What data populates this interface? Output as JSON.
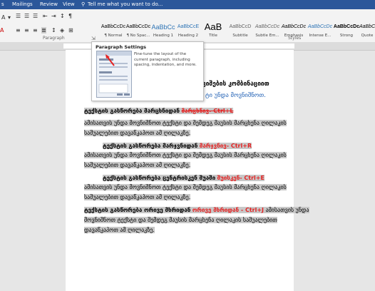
{
  "tabs": [
    "Mailings",
    "Review",
    "View"
  ],
  "tellme": "Tell me what you want to do...",
  "styles": [
    {
      "sample": "AaBbCcDc",
      "name": "¶ Normal",
      "color": "#222"
    },
    {
      "sample": "AaBbCcDc",
      "name": "¶ No Spac...",
      "color": "#222"
    },
    {
      "sample": "AaBbCc",
      "name": "Heading 1",
      "color": "#2e74b5"
    },
    {
      "sample": "AaBbCcE",
      "name": "Heading 2",
      "color": "#2e74b5"
    },
    {
      "sample": "AaB",
      "name": "Title",
      "color": "#222"
    },
    {
      "sample": "AaBbCcD",
      "name": "Subtitle",
      "color": "#666"
    },
    {
      "sample": "AaBbCcDc",
      "name": "Subtle Em...",
      "color": "#666"
    },
    {
      "sample": "AaBbCcDc",
      "name": "Emphasis",
      "color": "#444"
    },
    {
      "sample": "AaBbCcDc",
      "name": "Intense E...",
      "color": "#2e74b5"
    },
    {
      "sample": "AaBbCcDc",
      "name": "Strong",
      "color": "#222"
    },
    {
      "sample": "AaBbCcDc",
      "name": "Quote",
      "color": "#444"
    }
  ],
  "groups": {
    "paragraph": "Paragraph",
    "styles": "Styles"
  },
  "tooltip": {
    "title": "Paragraph Settings",
    "desc": "Fine-tune the layout of the current paragraph, including spacing, indentation, and more."
  },
  "doc": {
    "heading_partial": "ლავიშების კომბინაციით",
    "sub_partial": "ტი უნდა მოვნიშნოთ.",
    "p1_lead": "ტექსტის გასწორება მარცხნიდან",
    "p1_red": "მარცხნივ- Ctrl+L",
    "p1_l1": "ამისათვის უნდა მოვნიშნოთ ტექსტი და შემდეგ მაუსის მარცხენა ღილაკის",
    "p1_l2": "საშუალებით დავაწკაპოთ ამ ღილაკზე.",
    "p2_lead": "ტექსტის გასწორება მარჯვნიდან",
    "p2_red": "მარჯვნივ- Ctrl+R",
    "p2_l1": "ამისათვის უნდა მოვნიშნოთ ტექსტი და შემდეგ მაუსის მარცხენა ღილაკის",
    "p2_l2": "საშუალებით დავაწკაპოთ ამ ღილაკზე.",
    "p3_lead": "ტექსტის გასწორება ცენტრისკენ შუაში",
    "p3_red": "შუისკენ- Ctrl+E",
    "p3_l1": "ამისათვის უნდა მოვნიშნოთ ტექსტი და შემდეგ მაუსის მარცხენა ღილაკის",
    "p3_l2": "საშუალებით დავაწკაპოთ ამ ღილაკზე.",
    "p4_lead": "ტექსტის გასწორება ორივე მხრიდან",
    "p4_red": "ორივე მხრიდან - Ctrl+J",
    "p4_tail": "ამისათვის უნდა",
    "p4_l2": "მოვნიშნოთ ტექსტი და შემდეგ მაუსის მარცხენა ღილაკის საშუალებით",
    "p4_l3": "დავაწკაპოთ ამ ღილაკზე."
  }
}
